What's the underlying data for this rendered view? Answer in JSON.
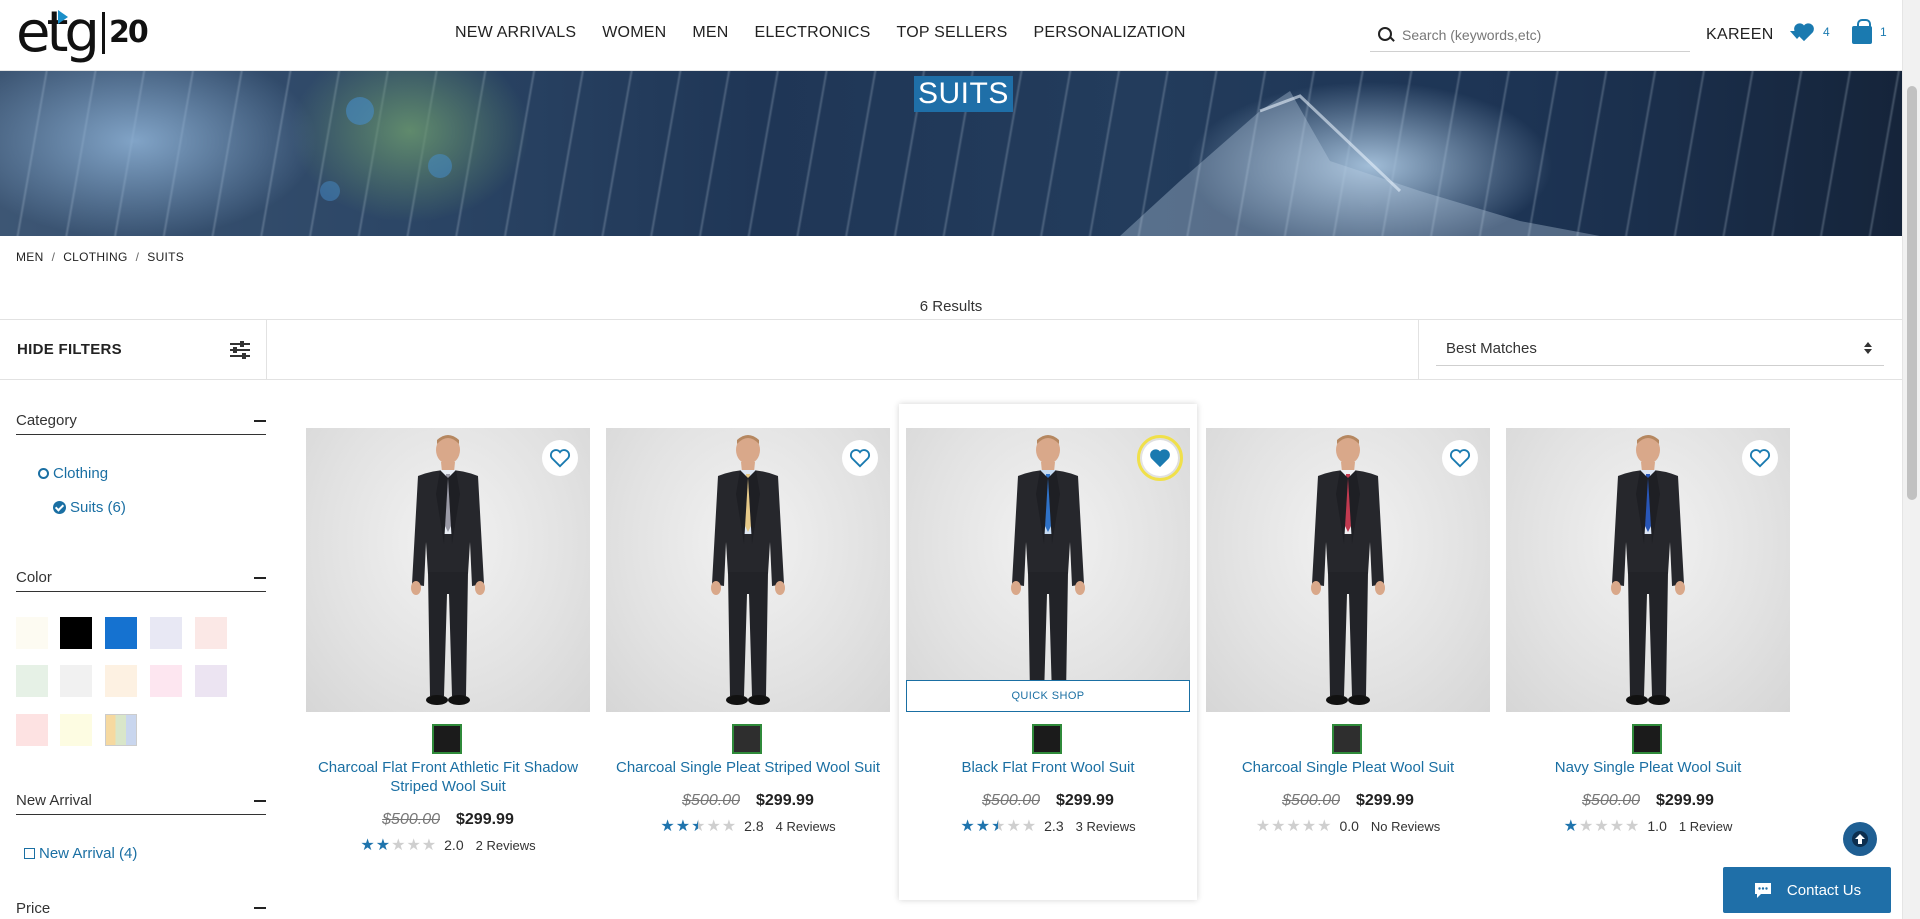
{
  "header": {
    "logo_text": "etg",
    "logo_badge": "20",
    "nav": [
      "NEW ARRIVALS",
      "WOMEN",
      "MEN",
      "ELECTRONICS",
      "TOP SELLERS",
      "PERSONALIZATION"
    ],
    "search_placeholder": "Search (keywords,etc)",
    "user_name": "KAREEN",
    "wishlist_count": "4",
    "cart_count": "1"
  },
  "hero": {
    "title": "SUITS"
  },
  "breadcrumb": [
    "MEN",
    "CLOTHING",
    "SUITS"
  ],
  "results_text": "6 Results",
  "filterbar": {
    "hide_filters": "HIDE FILTERS",
    "sort_value": "Best Matches"
  },
  "sidebar": {
    "category": {
      "title": "Category",
      "items": [
        "Clothing",
        "Suits (6)"
      ]
    },
    "color": {
      "title": "Color",
      "swatches": [
        "#fdfbf2",
        "#000000",
        "#1572d0",
        "#e8e8f4",
        "#fbe8e6",
        "#e6f1e6",
        "#f1f1f1",
        "#fdf1e2",
        "#fde6f0",
        "#ece4f2",
        "#fde2e2",
        "#fdfce2",
        "multi"
      ]
    },
    "new_arrival": {
      "title": "New Arrival",
      "item": "New Arrival (4)"
    },
    "price": {
      "title": "Price"
    }
  },
  "products": [
    {
      "name": "Charcoal Flat Front Athletic Fit Shadow Striped Wool Suit",
      "was": "$500.00",
      "now": "$299.99",
      "rating": "2.0",
      "stars": 2,
      "reviews": "2 Reviews",
      "tie": "#9a9aa6",
      "shirt": "#e9eef5",
      "swatch": "#1b1b1b"
    },
    {
      "name": "Charcoal Single Pleat Striped Wool Suit",
      "was": "$500.00",
      "now": "$299.99",
      "rating": "2.8",
      "stars": 2.5,
      "reviews": "4 Reviews",
      "tie": "#e6c989",
      "shirt": "#dde6f2",
      "swatch": "#2e2e2e"
    },
    {
      "name": "Black Flat Front Wool Suit",
      "was": "$500.00",
      "now": "$299.99",
      "rating": "2.3",
      "stars": 2.5,
      "reviews": "3 Reviews",
      "tie": "#2f72c8",
      "shirt": "#c6dbf2",
      "swatch": "#1b1b1b"
    },
    {
      "name": "Charcoal Single Pleat Wool Suit",
      "was": "$500.00",
      "now": "$299.99",
      "rating": "0.0",
      "stars": 0,
      "reviews": "No Reviews",
      "tie": "#c23a50",
      "shirt": "#f0f0f3",
      "swatch": "#2e2e2e"
    },
    {
      "name": "Navy Single Pleat Wool Suit",
      "was": "$500.00",
      "now": "$299.99",
      "rating": "1.0",
      "stars": 1,
      "reviews": "1 Review",
      "tie": "#2856b8",
      "shirt": "#dde6f4",
      "swatch": "#1b1b1b"
    }
  ],
  "quick_shop": "QUICK SHOP",
  "contact": "Contact Us"
}
